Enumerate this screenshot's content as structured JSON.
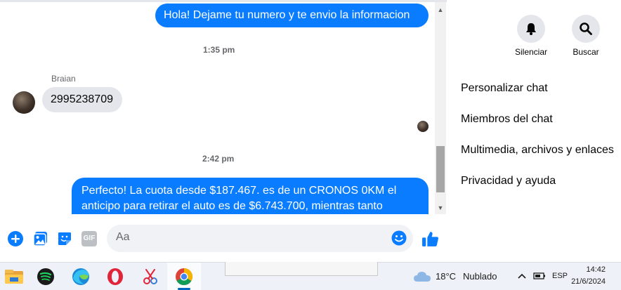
{
  "messages": {
    "outgoing_1": "Hola! Dejame tu numero y te envio la informacion",
    "time_1": "1:35 pm",
    "sender_name": "Braian",
    "incoming_1": "2995238709",
    "time_2": "2:42 pm",
    "outgoing_2_line1": "Perfecto! La cuota desde $187.467. es de un CRONOS 0KM el",
    "outgoing_2_line2": "anticipo para retirar el auto es de $6.743.700, mientras tanto"
  },
  "composer": {
    "placeholder": "Aa",
    "icons": [
      "plus-icon",
      "photo-icon",
      "sticker-icon",
      "gif-icon",
      "emoji-icon",
      "like-icon"
    ],
    "gif_label": "GIF"
  },
  "sidebar": {
    "mute_label": "Silenciar",
    "search_label": "Buscar",
    "menu": [
      "Personalizar chat",
      "Miembros del chat",
      "Multimedia, archivos y enlaces",
      "Privacidad y ayuda"
    ]
  },
  "taskbar": {
    "apps": [
      "file-explorer-icon",
      "spotify-icon",
      "edge-icon",
      "opera-icon",
      "snipping-icon",
      "chrome-icon"
    ],
    "weather_temp": "18°C",
    "weather_desc": "Nublado",
    "language": "ESP",
    "time": "14:42",
    "date": "21/6/2024"
  },
  "colors": {
    "messenger_blue": "#0a7cff",
    "incoming_bubble": "#e4e6eb",
    "taskbar_bg": "#eef1f7"
  }
}
